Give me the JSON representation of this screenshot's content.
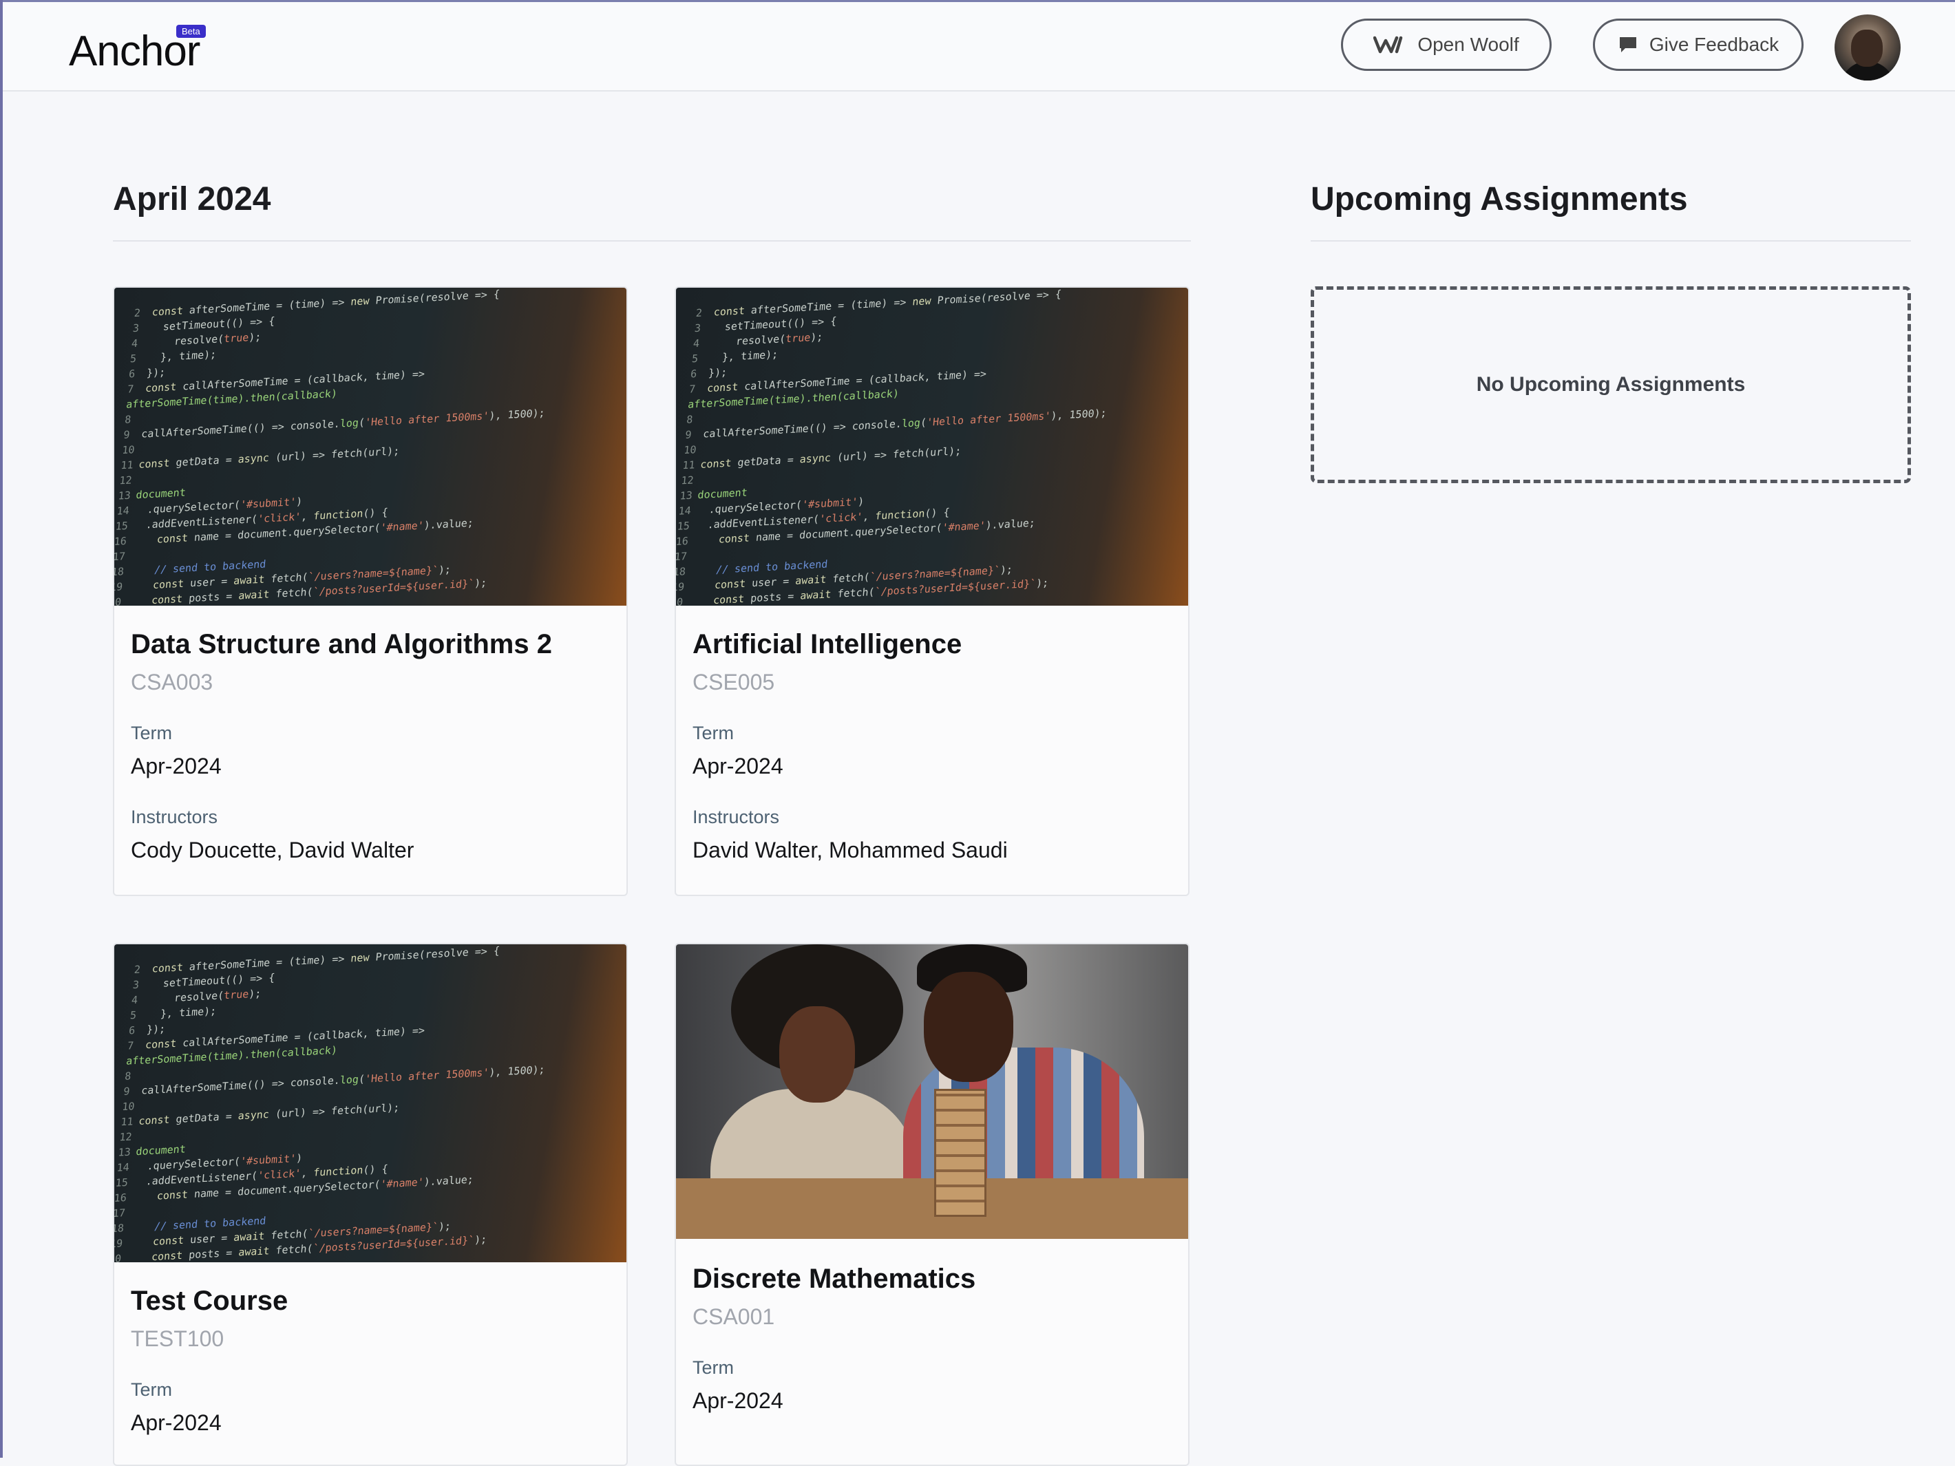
{
  "app": {
    "name": "Anchor",
    "badge": "Beta"
  },
  "header": {
    "open_woolf_label": "Open Woolf",
    "give_feedback_label": "Give Feedback"
  },
  "main": {
    "term_heading": "April 2024",
    "courses": [
      {
        "title": "Data Structure and Algorithms 2",
        "code": "CSA003",
        "term_label": "Term",
        "term": "Apr-2024",
        "instructors_label": "Instructors",
        "instructors": "Cody Doucette, David Walter"
      },
      {
        "title": "Artificial Intelligence",
        "code": "CSE005",
        "term_label": "Term",
        "term": "Apr-2024",
        "instructors_label": "Instructors",
        "instructors": "David Walter, Mohammed Saudi"
      },
      {
        "title": "Test Course",
        "code": "TEST100",
        "term_label": "Term",
        "term": "Apr-2024"
      },
      {
        "title": "Discrete Mathematics",
        "code": "CSA001",
        "term_label": "Term",
        "term": "Apr-2024"
      }
    ]
  },
  "aside": {
    "heading": "Upcoming Assignments",
    "empty_message": "No Upcoming Assignments"
  },
  "colors": {
    "badge": "#3a2ec9",
    "label": "#4d6172",
    "code": "#a1a5ad"
  }
}
